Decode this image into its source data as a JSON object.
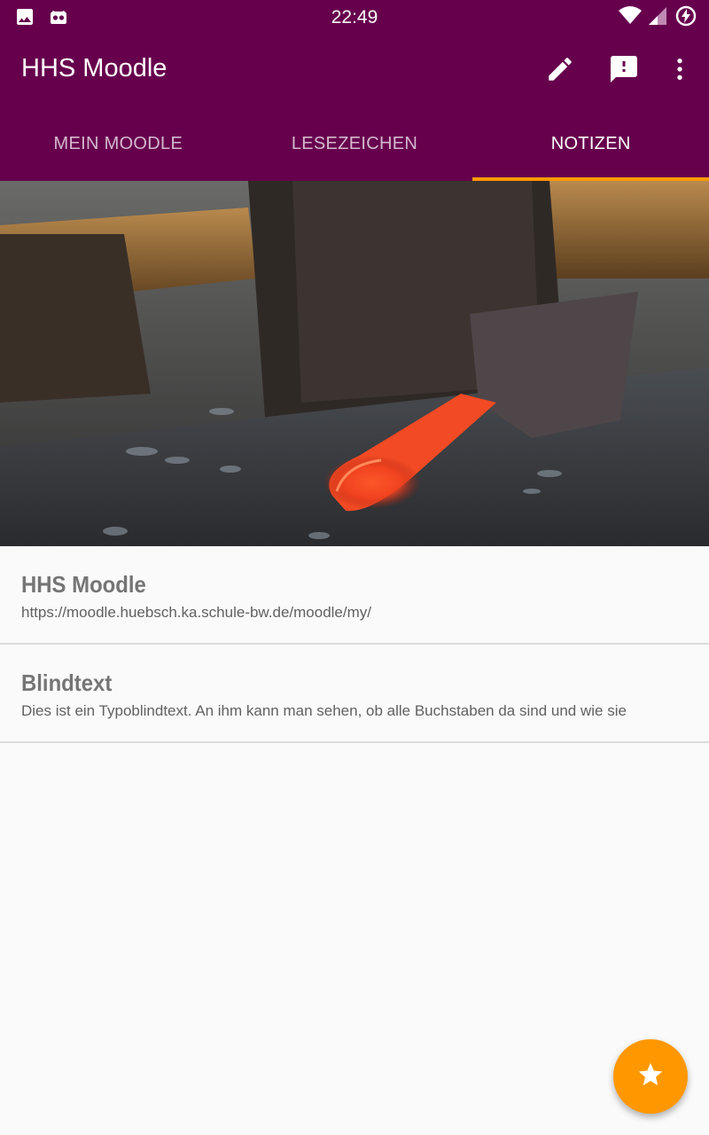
{
  "colors": {
    "primary": "#66004d",
    "accent": "#ff9800",
    "background": "#fafafa"
  },
  "status_bar": {
    "time": "22:49",
    "icons_left": [
      "image-icon",
      "android-debug-icon"
    ],
    "icons_right": [
      "wifi-icon",
      "signal-icon",
      "battery-charging-icon"
    ]
  },
  "toolbar": {
    "title": "HHS Moodle",
    "actions": [
      "edit-icon",
      "feedback-icon",
      "more-vert-icon"
    ]
  },
  "tabs": [
    {
      "label": "MEIN MOODLE",
      "active": false
    },
    {
      "label": "LESEZEICHEN",
      "active": false
    },
    {
      "label": "NOTIZEN",
      "active": true
    }
  ],
  "notes": [
    {
      "title": "HHS Moodle",
      "text": "https://moodle.huebsch.ka.schule-bw.de/moodle/my/"
    },
    {
      "title": "Blindtext",
      "text": "Dies ist ein Typoblindtext. An ihm kann man sehen, ob alle Buchstaben da sind und wie sie"
    }
  ],
  "fab": {
    "icon": "star-icon"
  }
}
